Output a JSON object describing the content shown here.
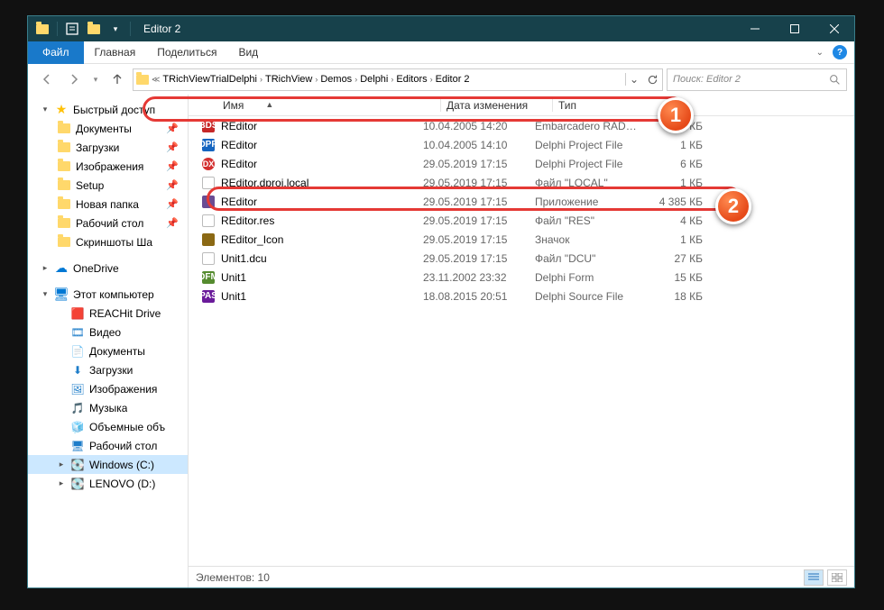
{
  "window": {
    "title": "Editor 2"
  },
  "ribbon": {
    "file": "Файл",
    "tabs": [
      "Главная",
      "Поделиться",
      "Вид"
    ]
  },
  "breadcrumbs": [
    "TRichViewTrialDelphi",
    "TRichView",
    "Demos",
    "Delphi",
    "Editors",
    "Editor 2"
  ],
  "search_placeholder": "Поиск: Editor 2",
  "columns": {
    "name": "Имя",
    "date": "Дата изменения",
    "type": "Тип",
    "size": ""
  },
  "nav": {
    "quick": {
      "label": "Быстрый доступ",
      "items": [
        {
          "label": "Документы",
          "pin": true
        },
        {
          "label": "Загрузки",
          "pin": true
        },
        {
          "label": "Изображения",
          "pin": true
        },
        {
          "label": "Setup",
          "pin": true
        },
        {
          "label": "Новая папка",
          "pin": true
        },
        {
          "label": "Рабочий стол",
          "pin": true
        },
        {
          "label": "Скриншоты Ша",
          "pin": false
        }
      ]
    },
    "onedrive": {
      "label": "OneDrive"
    },
    "pc": {
      "label": "Этот компьютер",
      "items": [
        {
          "label": "REACHit Drive",
          "kind": "reach"
        },
        {
          "label": "Видео",
          "kind": "vid"
        },
        {
          "label": "Документы",
          "kind": "doc"
        },
        {
          "label": "Загрузки",
          "kind": "dl"
        },
        {
          "label": "Изображения",
          "kind": "img"
        },
        {
          "label": "Музыка",
          "kind": "mus"
        },
        {
          "label": "Объемные объ",
          "kind": "obj"
        },
        {
          "label": "Рабочий стол",
          "kind": "desk"
        },
        {
          "label": "Windows (C:)",
          "kind": "drive",
          "sel": true
        },
        {
          "label": "LENOVO (D:)",
          "kind": "drive"
        }
      ]
    }
  },
  "files": [
    {
      "name": "REditor",
      "date": "10.04.2005 14:20",
      "type": "Embarcadero RAD…",
      "size": "8 КБ",
      "ico": "fi-red",
      "t": "BDS"
    },
    {
      "name": "REditor",
      "date": "10.04.2005 14:10",
      "type": "Delphi Project File",
      "size": "1 КБ",
      "ico": "fi-blue",
      "t": "DPR"
    },
    {
      "name": "REditor",
      "date": "29.05.2019 17:15",
      "type": "Delphi Project File",
      "size": "6 КБ",
      "ico": "fi-dx",
      "t": "DX"
    },
    {
      "name": "REditor.dproj.local",
      "date": "29.05.2019 17:15",
      "type": "Файл \"LOCAL\"",
      "size": "1 КБ",
      "ico": "fi-wh",
      "t": ""
    },
    {
      "name": "REditor",
      "date": "29.05.2019 17:15",
      "type": "Приложение",
      "size": "4 385 КБ",
      "ico": "fi-app",
      "t": ""
    },
    {
      "name": "REditor.res",
      "date": "29.05.2019 17:15",
      "type": "Файл \"RES\"",
      "size": "4 КБ",
      "ico": "fi-wh",
      "t": ""
    },
    {
      "name": "REditor_Icon",
      "date": "29.05.2019 17:15",
      "type": "Значок",
      "size": "1 КБ",
      "ico": "fi-ico2",
      "t": ""
    },
    {
      "name": "Unit1.dcu",
      "date": "29.05.2019 17:15",
      "type": "Файл \"DCU\"",
      "size": "27 КБ",
      "ico": "fi-wh",
      "t": ""
    },
    {
      "name": "Unit1",
      "date": "23.11.2002 23:32",
      "type": "Delphi Form",
      "size": "15 КБ",
      "ico": "fi-grn",
      "t": "DFM"
    },
    {
      "name": "Unit1",
      "date": "18.08.2015 20:51",
      "type": "Delphi Source File",
      "size": "18 КБ",
      "ico": "fi-prp",
      "t": "PAS"
    }
  ],
  "status": {
    "count_label": "Элементов: 10"
  },
  "badges": {
    "one": "1",
    "two": "2"
  }
}
